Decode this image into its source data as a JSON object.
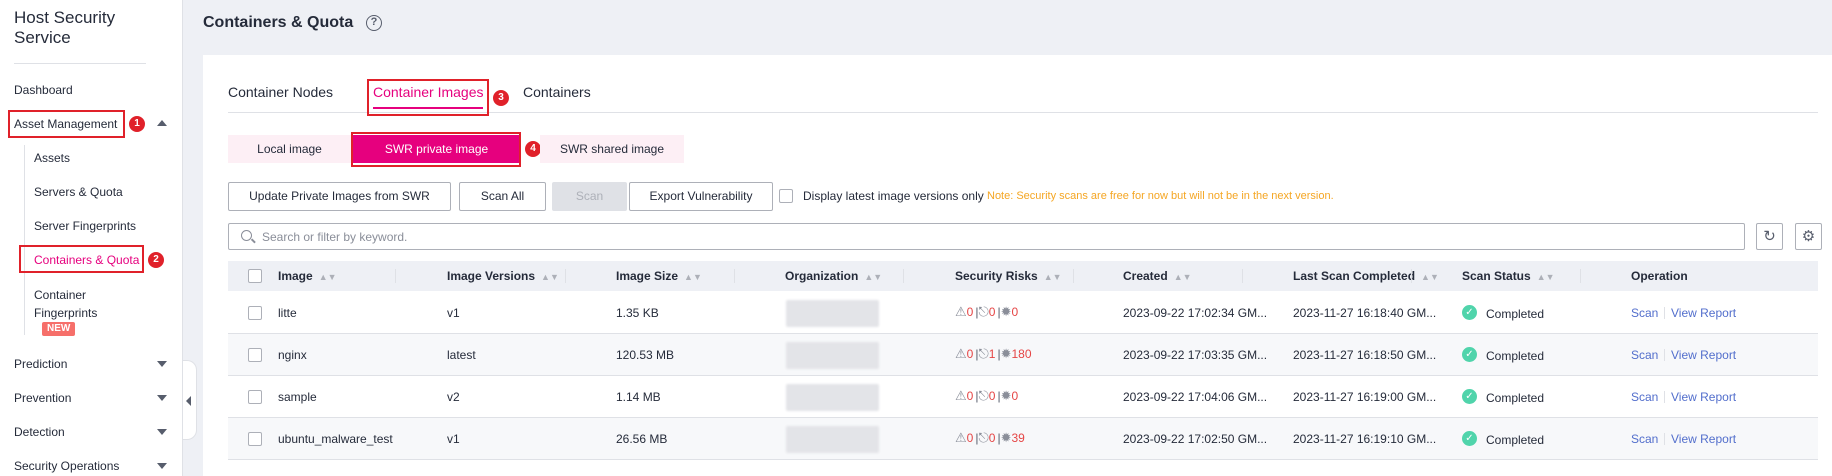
{
  "sidebar": {
    "title": "Host Security Service",
    "items": [
      {
        "label": "Dashboard"
      },
      {
        "label": "Asset Management"
      },
      {
        "label": "Prediction"
      },
      {
        "label": "Prevention"
      },
      {
        "label": "Detection"
      },
      {
        "label": "Security Operations"
      }
    ],
    "sub_items": [
      {
        "label": "Assets"
      },
      {
        "label": "Servers & Quota"
      },
      {
        "label": "Server Fingerprints"
      },
      {
        "label": "Containers & Quota"
      },
      {
        "label": "Container Fingerprints"
      }
    ],
    "new_badge": "NEW",
    "callouts": [
      "1",
      "2",
      "3",
      "4"
    ]
  },
  "header": {
    "title": "Containers & Quota",
    "help_icon": "?"
  },
  "tabs": [
    {
      "label": "Container Nodes"
    },
    {
      "label": "Container Images"
    },
    {
      "label": "Containers"
    }
  ],
  "segments": [
    {
      "label": "Local image"
    },
    {
      "label": "SWR private image"
    },
    {
      "label": "SWR shared image"
    }
  ],
  "toolbar": {
    "update_label": "Update Private Images from SWR",
    "scan_all_label": "Scan All",
    "scan_label": "Scan",
    "export_label": "Export Vulnerability",
    "latest_only_label": "Display latest image versions only",
    "note": "Note: Security scans are free for now but will not be in the next version."
  },
  "search": {
    "placeholder": "Search or filter by keyword."
  },
  "table": {
    "headers": [
      "Image",
      "Image Versions",
      "Image Size",
      "Organization",
      "Security Risks",
      "Created",
      "Last Scan Completed",
      "Scan Status",
      "Operation"
    ],
    "rows": [
      {
        "image": "litte",
        "version": "v1",
        "size": "1.35 KB",
        "risk_a": "0",
        "risk_b": "0",
        "risk_c": "0",
        "created": "2023-09-22 17:02:34 GM...",
        "last_scan": "2023-11-27 16:18:40 GM...",
        "status": "Completed"
      },
      {
        "image": "nginx",
        "version": "latest",
        "size": "120.53 MB",
        "risk_a": "0",
        "risk_b": "1",
        "risk_c": "180",
        "created": "2023-09-22 17:03:35 GM...",
        "last_scan": "2023-11-27 16:18:50 GM...",
        "status": "Completed"
      },
      {
        "image": "sample",
        "version": "v2",
        "size": "1.14 MB",
        "risk_a": "0",
        "risk_b": "0",
        "risk_c": "0",
        "created": "2023-09-22 17:04:06 GM...",
        "last_scan": "2023-11-27 16:19:00 GM...",
        "status": "Completed"
      },
      {
        "image": "ubuntu_malware_test",
        "version": "v1",
        "size": "26.56 MB",
        "risk_a": "0",
        "risk_b": "0",
        "risk_c": "39",
        "created": "2023-09-22 17:02:50 GM...",
        "last_scan": "2023-11-27 16:19:10 GM...",
        "status": "Completed"
      }
    ],
    "op_scan": "Scan",
    "op_report": "View Report"
  },
  "colors": {
    "accent": "#e6007e",
    "callout": "#e0212a",
    "link": "#526ecc",
    "risk": "#e54545",
    "success": "#50d4ab",
    "note": "#f5a623"
  }
}
